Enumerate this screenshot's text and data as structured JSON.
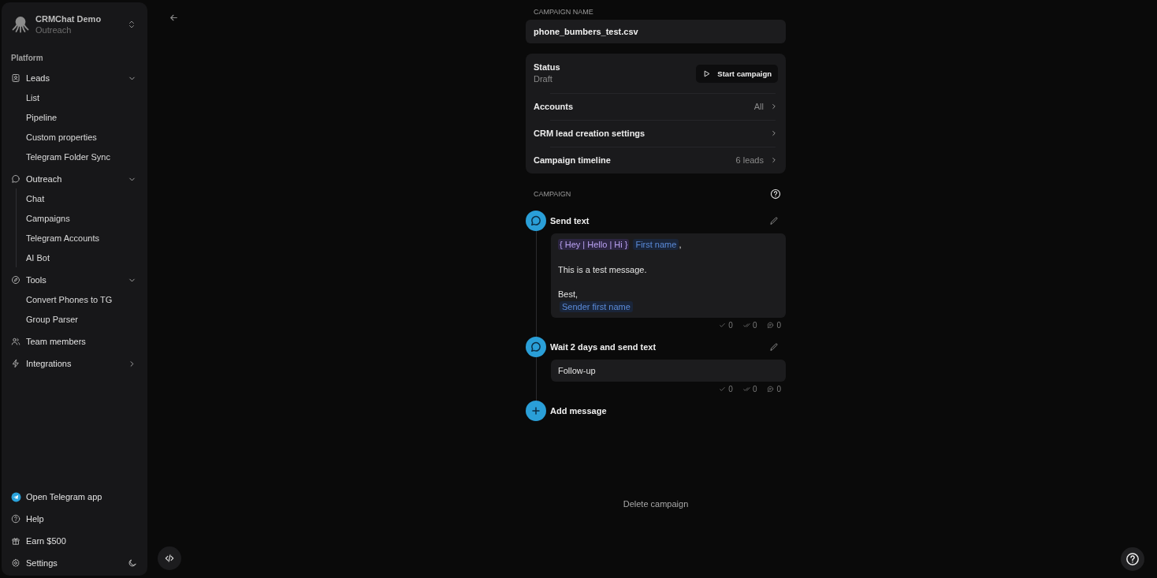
{
  "workspace": {
    "name": "CRMChat Demo",
    "subtitle": "Outreach"
  },
  "sidebar": {
    "section": "Platform",
    "groups": [
      {
        "kind": "group",
        "label": "Leads",
        "expanded": true,
        "selected": false,
        "children": [
          {
            "label": "List"
          },
          {
            "label": "Pipeline"
          },
          {
            "label": "Custom properties"
          },
          {
            "label": "Telegram Folder Sync"
          }
        ]
      },
      {
        "kind": "group",
        "label": "Outreach",
        "expanded": true,
        "selected": true,
        "children": [
          {
            "label": "Chat"
          },
          {
            "label": "Campaigns"
          },
          {
            "label": "Telegram Accounts"
          },
          {
            "label": "AI Bot"
          }
        ]
      },
      {
        "kind": "group",
        "label": "Tools",
        "expanded": true,
        "selected": false,
        "children": [
          {
            "label": "Convert Phones to TG"
          },
          {
            "label": "Group Parser"
          }
        ]
      },
      {
        "kind": "link",
        "label": "Team members",
        "selected": false
      },
      {
        "kind": "group",
        "label": "Integrations",
        "expanded": false,
        "selected": false
      }
    ],
    "footer": [
      {
        "label": "Open Telegram app"
      },
      {
        "label": "Help"
      },
      {
        "label": "Earn $500"
      },
      {
        "label": "Settings"
      }
    ]
  },
  "campaign_name": {
    "label": "CAMPAIGN NAME",
    "value": "phone_bumbers_test.csv"
  },
  "settings_card": {
    "status": {
      "label": "Status",
      "value": "Draft",
      "action": "Start campaign"
    },
    "rows": [
      {
        "label": "Accounts",
        "value": "All"
      },
      {
        "label": "CRM lead creation settings"
      },
      {
        "label": "Campaign timeline",
        "value": "6 leads"
      }
    ]
  },
  "campaign": {
    "heading": "CAMPAIGN",
    "steps": [
      {
        "title": "Send text",
        "paragraphs": [
          {
            "lines": [
              {
                "parts": [
                  {
                    "kind": "spintax",
                    "text": "{ Hey | Hello | Hi }"
                  },
                  {
                    "kind": "variable",
                    "text": "First name"
                  },
                  {
                    "kind": "text",
                    "text": ","
                  }
                ]
              }
            ]
          },
          {
            "lines": [
              {
                "parts": [
                  {
                    "kind": "text",
                    "text": "This is a test message."
                  }
                ]
              }
            ]
          },
          {
            "lines": [
              {
                "parts": [
                  {
                    "kind": "text",
                    "text": "Best,"
                  }
                ]
              },
              {
                "parts": [
                  {
                    "kind": "variable",
                    "text": "Sender first name"
                  }
                ]
              }
            ]
          }
        ],
        "stats": [
          {
            "count": "0"
          },
          {
            "count": "0"
          },
          {
            "count": "0"
          }
        ]
      },
      {
        "title": "Wait 2 days and send text",
        "paragraphs": [
          {
            "lines": [
              {
                "parts": [
                  {
                    "kind": "text",
                    "text": "Follow-up"
                  }
                ]
              }
            ]
          }
        ],
        "stats": [
          {
            "count": "0"
          },
          {
            "count": "0"
          },
          {
            "count": "0"
          }
        ]
      }
    ],
    "add_label": "Add message"
  },
  "delete_label": "Delete campaign"
}
